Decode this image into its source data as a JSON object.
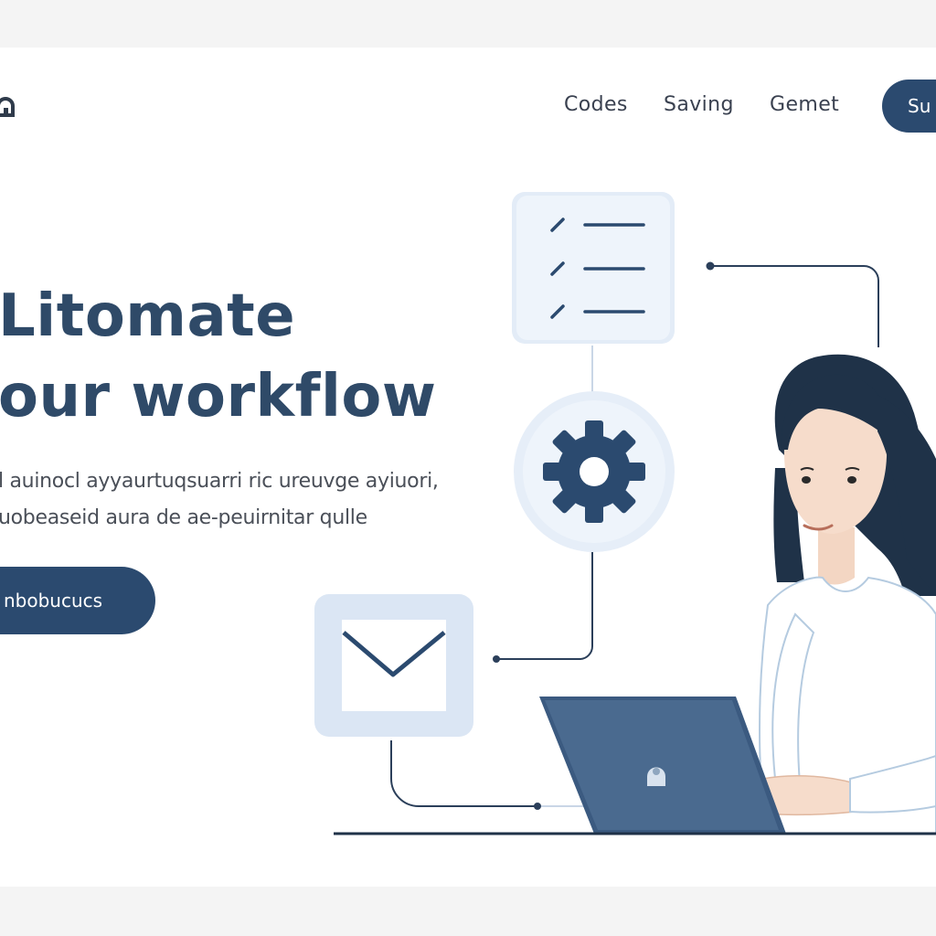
{
  "nav": {
    "links": [
      "Codes",
      "Saving",
      "Gemet"
    ],
    "cta_label": "Su"
  },
  "hero": {
    "headline_line1": "Litomate",
    "headline_line2": "our workflow",
    "subtext_line1": "l auinocl ayyaurtuqsuarri ric ureuvge ayiuori,",
    "subtext_line2": "uobeaseid aura de ae-peuirnitar qulle",
    "cta_label": "nbobucucs"
  },
  "colors": {
    "primary": "#2b4a6f",
    "panel": "#e3ecf7",
    "heading": "#2f4a68"
  },
  "icons": [
    "checklist-icon",
    "gear-icon",
    "mail-icon",
    "logo-icon"
  ]
}
